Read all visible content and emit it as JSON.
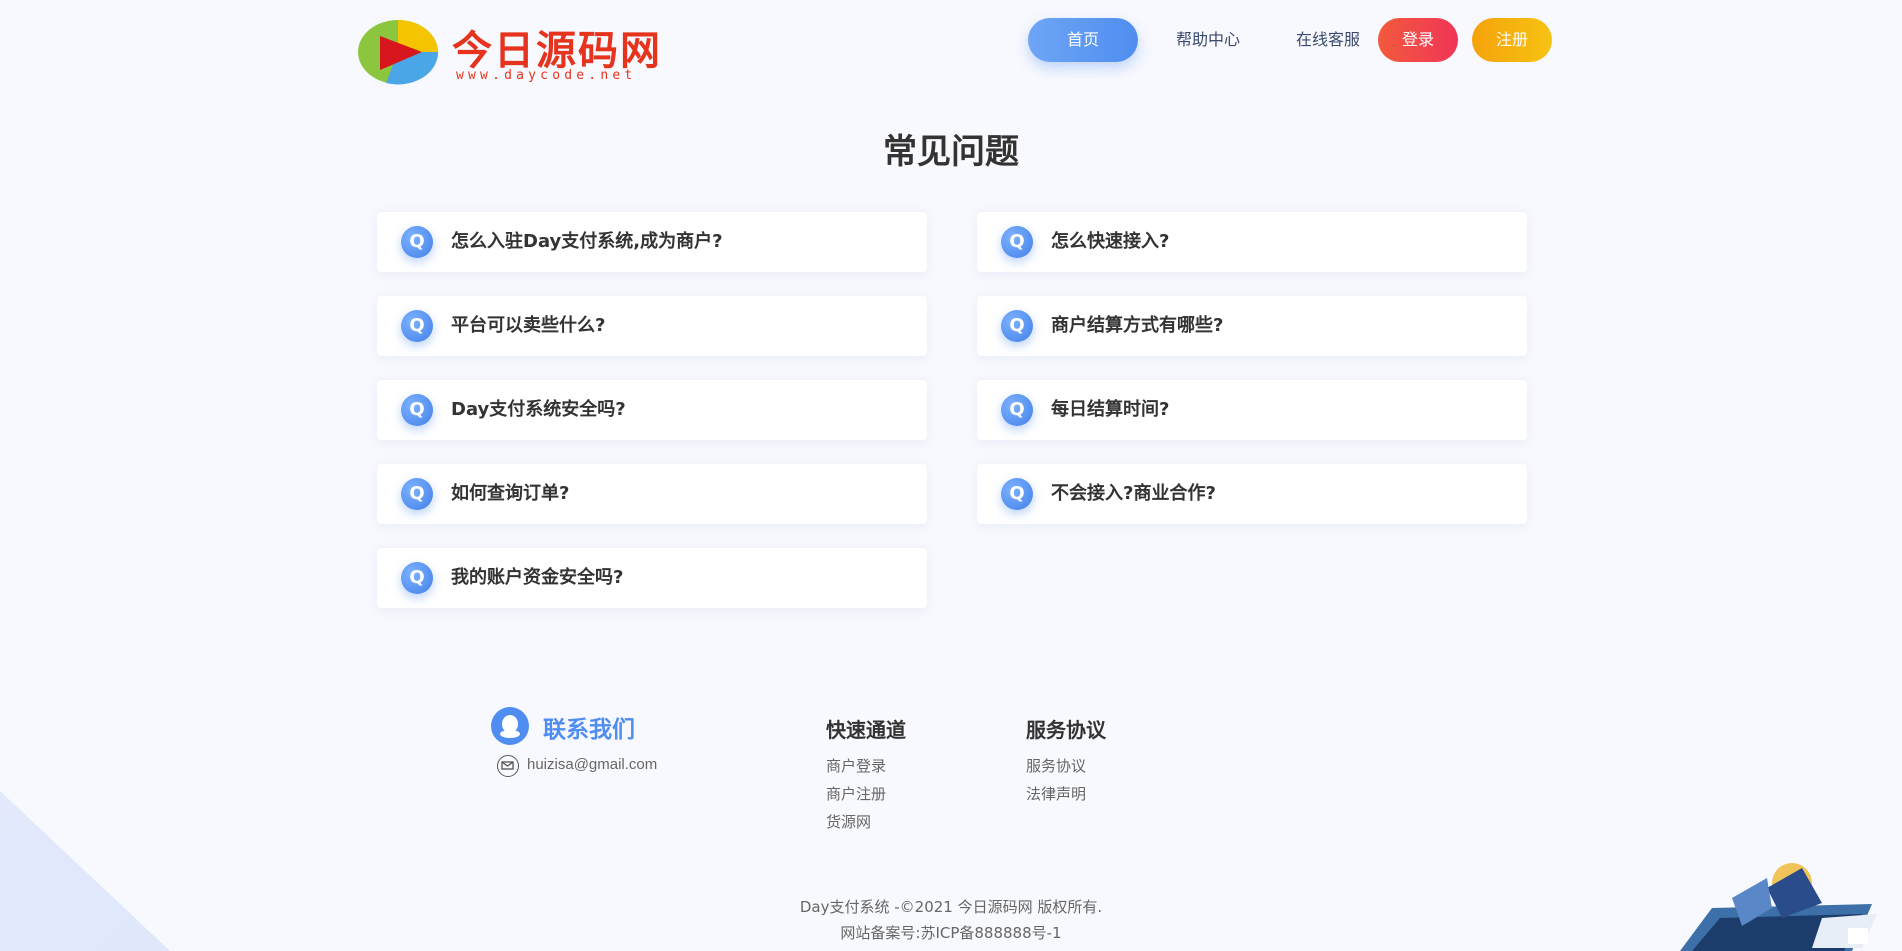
{
  "header": {
    "logo_title": "今日源码网",
    "logo_subtitle": "www.daycode.net",
    "nav": {
      "home": "首页",
      "help": "帮助中心",
      "service": "在线客服",
      "login": "登录",
      "register": "注册"
    }
  },
  "faq": {
    "title": "常见问题",
    "icon_letter": "Q",
    "items": [
      "怎么入驻Day支付系统,成为商户?",
      "怎么快速接入?",
      "平台可以卖些什么?",
      "商户结算方式有哪些?",
      "Day支付系统安全吗?",
      "每日结算时间?",
      "如何查询订单?",
      "不会接入?商业合作?",
      "我的账户资金安全吗?"
    ]
  },
  "footer": {
    "contact_title": "联系我们",
    "email": "huizisa@gmail.com",
    "quick_title": "快速通道",
    "quick_links": [
      "商户登录",
      "商户注册",
      "货源网"
    ],
    "agreement_title": "服务协议",
    "agreement_links": [
      "服务协议",
      "法律声明"
    ],
    "copyright": "Day支付系统 -©2021 今日源码网 版权所有.",
    "icp": "网站备案号:苏ICP备888888号-1"
  },
  "colors": {
    "accent_blue": "#4f8ef0",
    "brand_red": "#e5331d",
    "login_red": "#f03558",
    "register_yellow": "#f5b20e"
  }
}
